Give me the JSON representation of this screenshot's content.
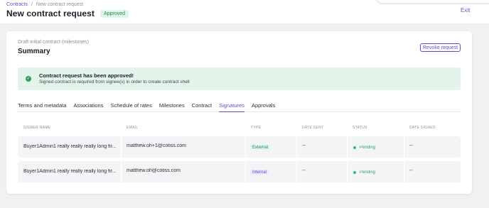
{
  "breadcrumb": {
    "parent": "Contracts",
    "separator": "/",
    "current": "New contract request"
  },
  "header": {
    "title": "New contract request",
    "status_badge": "Approved",
    "exit_label": "Exit"
  },
  "card": {
    "subtitle": "Draft initial contract (milestones)",
    "title": "Summary",
    "revoke_label": "Revoke request"
  },
  "alert": {
    "title": "Contract request has been approved!",
    "text": "Signed contract is required from signee(s) in order to create contract shell",
    "icon": "check-circle-icon"
  },
  "tabs": [
    {
      "label": "Terms and metadata",
      "active": false
    },
    {
      "label": "Associations",
      "active": false
    },
    {
      "label": "Schedule of rates",
      "active": false
    },
    {
      "label": "Milestones",
      "active": false
    },
    {
      "label": "Contract",
      "active": false
    },
    {
      "label": "Signatures",
      "active": true
    },
    {
      "label": "Approvals",
      "active": false
    }
  ],
  "table": {
    "headers": [
      "SIGNER NAME",
      "EMAIL",
      "TYPE",
      "DATE SENT",
      "STATUS",
      "DATE SIGNED"
    ],
    "rows": [
      {
        "name": "Buyer1Admin1 really really really long fir...",
        "email": "matthew.oh+1@cotiss.com",
        "type": "External",
        "date_sent": "--",
        "status": "Pending",
        "date_signed": "--"
      },
      {
        "name": "Buyer1Admin1 really really really long fir...",
        "email": "matthew.oh@cotiss.com",
        "type": "Internal",
        "date_sent": "--",
        "status": "Pending",
        "date_signed": "--"
      }
    ]
  },
  "colors": {
    "accent": "#5a4fcf",
    "success": "#2f9e5b",
    "alert_bg": "#e3f5ea"
  }
}
